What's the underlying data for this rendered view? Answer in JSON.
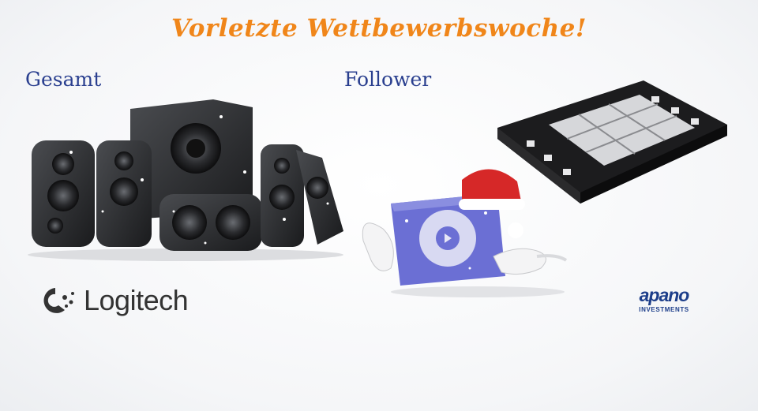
{
  "headline": "Vorletzte Wettbewerbswoche!",
  "categories": {
    "overall": "Gesamt",
    "followers": "Follower"
  },
  "prizes": {
    "overall_prize_icon": "speaker-system-icon",
    "followers_prize_icon": "music-player-icon",
    "board_prize_icon": "game-board-icon"
  },
  "sponsors": {
    "logitech": "Logitech",
    "apano_name": "apano",
    "apano_sub": "INVESTMENTS"
  },
  "colors": {
    "headline": "#f0861a",
    "category_labels": "#2a3f8f",
    "apano_brand": "#1d3e8a"
  }
}
